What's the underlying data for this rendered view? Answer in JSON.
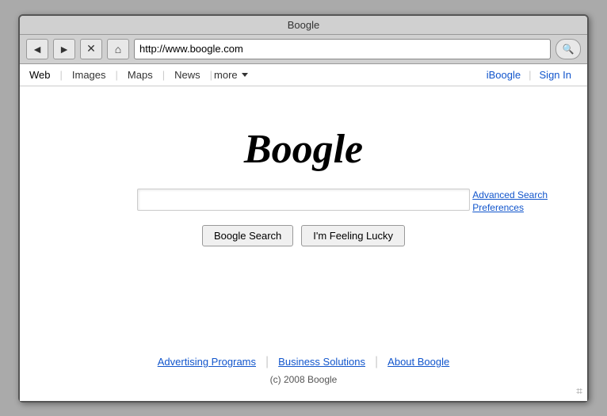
{
  "browser": {
    "title": "Boogle",
    "address": "http://www.boogle.com"
  },
  "nav": {
    "back_label": "◄",
    "forward_label": "►",
    "stop_label": "✕",
    "home_label": "⌂",
    "search_icon": "🔍",
    "left_links": [
      {
        "label": "Web",
        "active": true
      },
      {
        "label": "Images"
      },
      {
        "label": "Maps"
      },
      {
        "label": "News"
      },
      {
        "label": "more"
      }
    ],
    "right_links": [
      {
        "label": "iBoogle"
      },
      {
        "label": "Sign In"
      }
    ]
  },
  "main": {
    "logo": "Boogle",
    "search_placeholder": "",
    "advanced_search_label": "Advanced Search",
    "preferences_label": "Preferences",
    "search_button_label": "Boogle Search",
    "lucky_button_label": "I'm Feeling Lucky"
  },
  "footer": {
    "links": [
      {
        "label": "Advertising Programs"
      },
      {
        "label": "Business Solutions"
      },
      {
        "label": "About Boogle"
      }
    ],
    "copyright": "(c) 2008 Boogle"
  }
}
